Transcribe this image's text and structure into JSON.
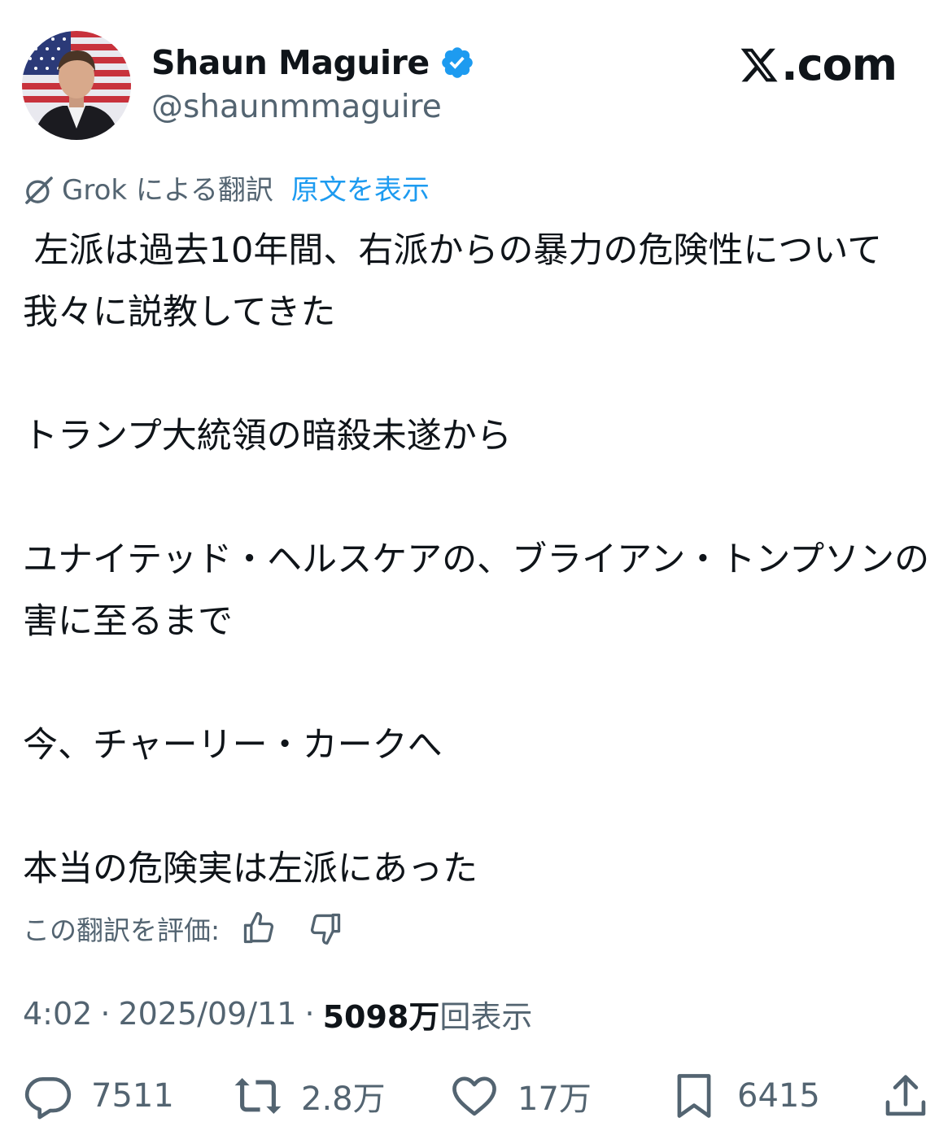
{
  "author": {
    "display_name": "Shaun Maguire",
    "handle": "@shaunmmaguire",
    "verified_color": "#1d9bf0"
  },
  "brand": {
    "label": ".com"
  },
  "translation": {
    "label": "Grok による翻訳",
    "show_original": "原文を表示"
  },
  "tweet": {
    "paragraphs": [
      " 左派は過去10年間、右派からの暴力の危険性について我々に説教してきた",
      "トランプ大統領の暗殺未遂から",
      "ユナイテッド・ヘルスケアの、ブライアン・トンプソンの害に至るまで",
      "今、チャーリー・カークへ",
      "本当の危険実は左派にあった"
    ]
  },
  "rating": {
    "label": "この翻訳を評価:"
  },
  "meta": {
    "time": "4:02",
    "date": "2025/09/11",
    "views_count": "5098万",
    "views_label": "回表示"
  },
  "actions": {
    "replies": "7511",
    "reposts": "2.8万",
    "likes": "17万",
    "bookmarks": "6415"
  },
  "colors": {
    "text": "#0f1419",
    "secondary": "#536471",
    "link": "#1d9bf0"
  }
}
